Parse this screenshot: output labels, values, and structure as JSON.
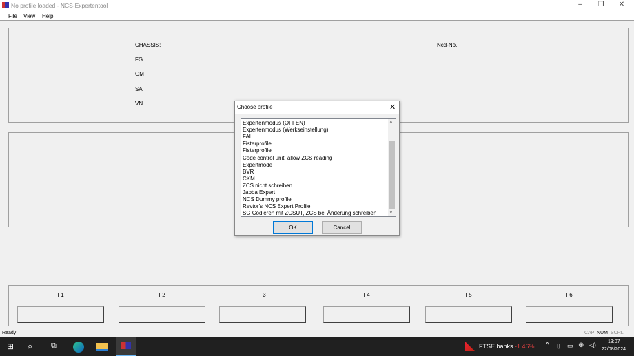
{
  "window": {
    "title": "No profile loaded - NCS-Expertentool",
    "minimize": "–",
    "restore": "❐",
    "close": "✕"
  },
  "menu": [
    "File",
    "View",
    "Help"
  ],
  "info": {
    "chassis": "CHASSIS:",
    "fg": "FG",
    "gm": "GM",
    "sa": "SA",
    "vn": "VN",
    "ncd": "Ncd-No.:"
  },
  "fkeys": [
    "F1",
    "F2",
    "F3",
    "F4",
    "F5",
    "F6"
  ],
  "status": {
    "text": "Ready",
    "cap": "CAP",
    "num": "NUM",
    "scrl": "SCRL"
  },
  "dialog": {
    "title": "Choose profile",
    "close": "✕",
    "ok": "OK",
    "cancel": "Cancel",
    "items": [
      "Expertenmodus (OFFEN)",
      "Expertenmodus (Werkseinstellung)",
      "FAL",
      "Fisterprofile",
      "Fisterprofile",
      "Code control unit, allow ZCS reading",
      "Expertmode",
      "BVR",
      "CKM",
      "ZCS nicht schreiben",
      "Jabba Expert",
      "NCS Dummy profile",
      "Revtor's NCS Expert Profile",
      "SG Codieren mit ZCSUT, ZCS bei Änderung schreiben"
    ],
    "scroll_up": "˄",
    "scroll_down": "˅"
  },
  "taskbar": {
    "widget": "FTSE banks",
    "change": "-1.46%",
    "time": "13:07",
    "date": "22/08/2024",
    "change_color": "#e04040"
  }
}
